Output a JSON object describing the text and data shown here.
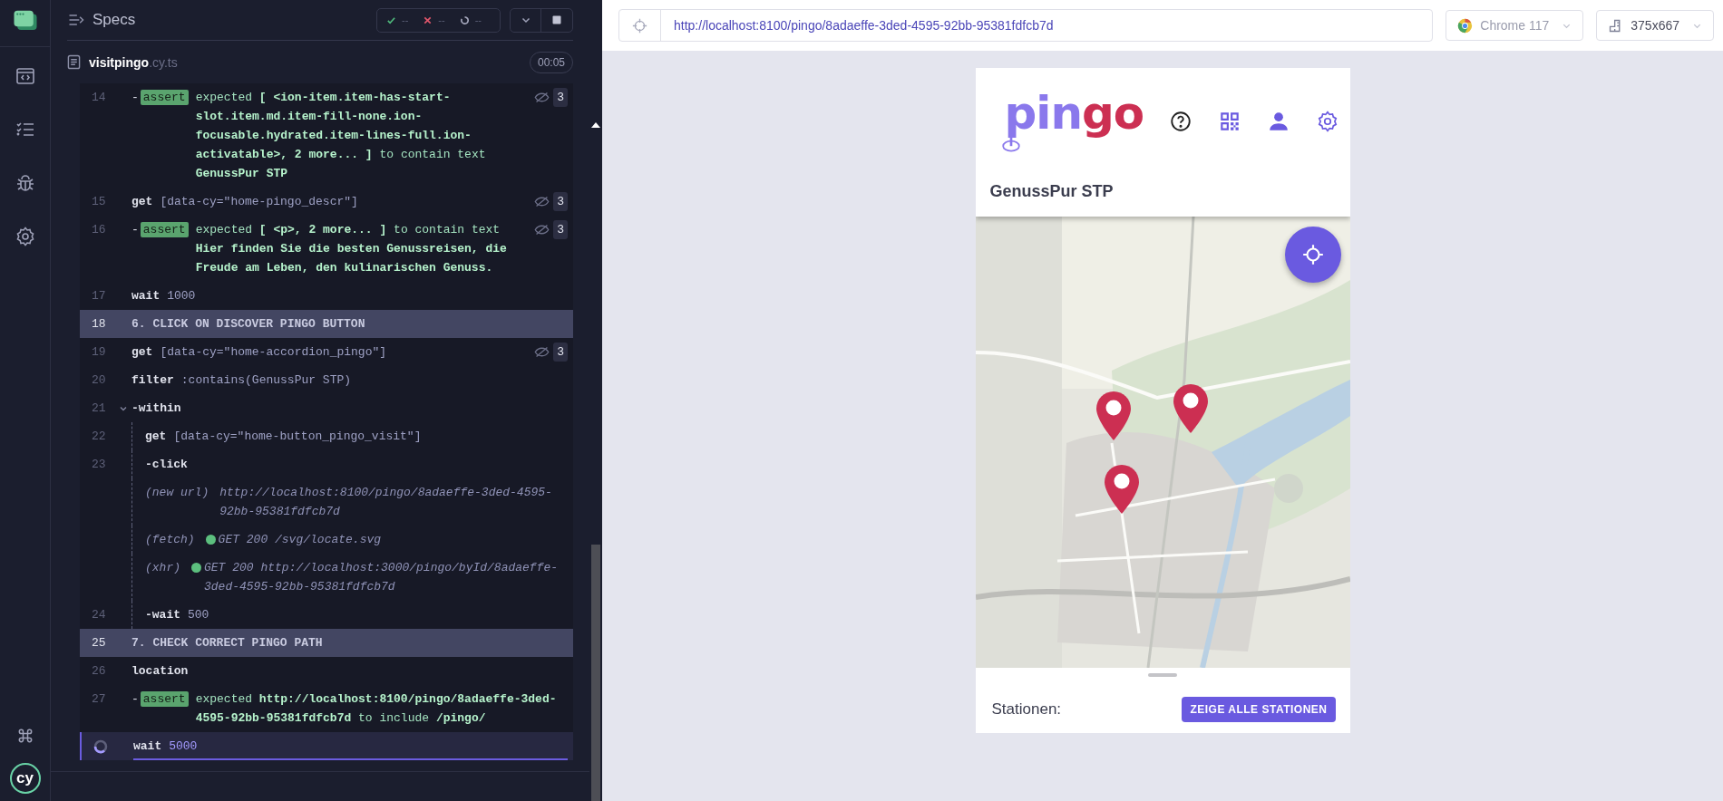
{
  "rail": {
    "brand": "cy"
  },
  "specs_header": {
    "title": "Specs",
    "passed": "--",
    "failed": "--",
    "pending": "--"
  },
  "spec_file": {
    "name": "visitpingo",
    "extension": ".cy.ts",
    "duration": "00:05"
  },
  "log": [
    {
      "kind": "command",
      "num": "14",
      "prefix": "-",
      "name": "assert",
      "tagged": true,
      "message": "expected **[ <ion-item.item-has-start-slot.item.md.item-fill-none.ion-focusable.hydrated.item-lines-full.ion-activatable>, 2 more... ]** to contain text **GenussPur STP**",
      "count": "3"
    },
    {
      "kind": "command",
      "num": "15",
      "name": "get",
      "tagged": false,
      "message": "[data-cy=\"home-pingo_descr\"]",
      "count": "3"
    },
    {
      "kind": "command",
      "num": "16",
      "prefix": "-",
      "name": "assert",
      "tagged": true,
      "message": "expected **[ <p>, 2 more... ]** to contain text **Hier finden Sie die besten Genussreisen, die Freude am Leben, den kulinarischen Genuss.**",
      "count": "3"
    },
    {
      "kind": "command",
      "num": "17",
      "name": "wait",
      "tagged": false,
      "message": "1000"
    },
    {
      "kind": "section",
      "num": "18",
      "title": "6. CLICK ON DISCOVER PINGO BUTTON"
    },
    {
      "kind": "command",
      "num": "19",
      "name": "get",
      "tagged": false,
      "message": "[data-cy=\"home-accordion_pingo\"]",
      "count": "3"
    },
    {
      "kind": "command",
      "num": "20",
      "name": "filter",
      "tagged": false,
      "message": ":contains(GenussPur STP)"
    },
    {
      "kind": "group",
      "num": "21",
      "prefix": "-",
      "name": "within",
      "expanded": true,
      "children": [
        {
          "kind": "command",
          "num": "22",
          "name": "get",
          "tagged": false,
          "message": "[data-cy=\"home-button_pingo_visit\"]"
        },
        {
          "kind": "command",
          "num": "23",
          "prefix": "-",
          "name": "click",
          "tagged": false
        },
        {
          "kind": "event",
          "label": "(new url)",
          "message": "http://localhost:8100/pingo/8adaeffe-3ded-4595-92bb-95381fdfcb7d"
        },
        {
          "kind": "event",
          "label": "(fetch)",
          "color": "#5cbf7e",
          "message": "GET 200 /svg/locate.svg"
        },
        {
          "kind": "event",
          "label": "(xhr)",
          "color": "#5cbf7e",
          "message": "GET 200 http://localhost:3000/pingo/byId/8adaeffe-3ded-4595-92bb-95381fdfcb7d"
        },
        {
          "kind": "command",
          "num": "24",
          "prefix": "-",
          "name": "wait",
          "tagged": false,
          "message": "500"
        }
      ]
    },
    {
      "kind": "section",
      "num": "25",
      "title": "7. CHECK CORRECT PINGO PATH"
    },
    {
      "kind": "command",
      "num": "26",
      "name": "location",
      "tagged": false
    },
    {
      "kind": "command",
      "num": "27",
      "prefix": "-",
      "name": "assert",
      "tagged": true,
      "message": "expected **http://localhost:8100/pingo/8adaeffe-3ded-4595-92bb-95381fdfcb7d** to include **/pingo/**"
    },
    {
      "kind": "running",
      "name": "wait",
      "message": "5000"
    }
  ],
  "browser_bar": {
    "url": "http://localhost:8100/pingo/8adaeffe-3ded-4595-92bb-95381fdfcb7d",
    "browser": "Chrome 117",
    "viewport": "375x667"
  },
  "app": {
    "logo": [
      {
        "text": "pin",
        "color": "#8a78ec"
      },
      {
        "text": "go",
        "color": "#cc2f52"
      }
    ],
    "title": "GenussPur STP",
    "stations_label": "Stationen:",
    "stations_button": "ZEIGE ALLE STATIONEN"
  }
}
